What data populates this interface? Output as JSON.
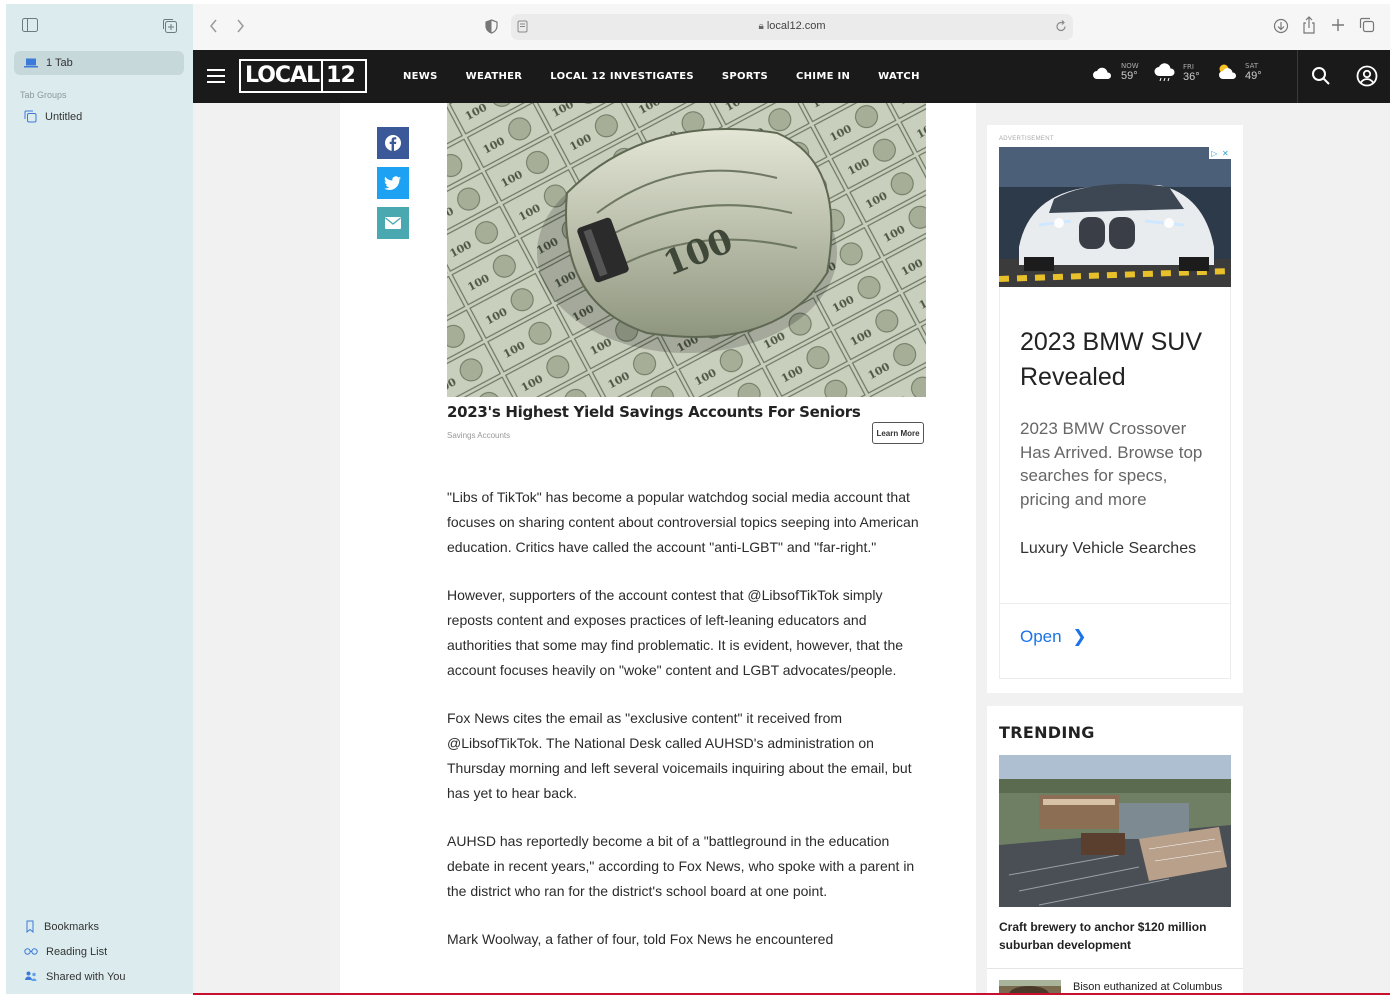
{
  "browser": {
    "sidebar": {
      "tab_count_label": "1 Tab",
      "tab_groups_title": "Tab Groups",
      "untitled_group": "Untitled",
      "bookmarks": "Bookmarks",
      "reading_list": "Reading List",
      "shared_with_you": "Shared with You"
    },
    "url": "local12.com"
  },
  "site": {
    "logo": "LOCAL",
    "logo_number": "12",
    "nav": [
      "NEWS",
      "WEATHER",
      "LOCAL 12 INVESTIGATES",
      "SPORTS",
      "CHIME IN",
      "WATCH"
    ],
    "weather": [
      {
        "label": "NOW",
        "temp": "59°",
        "icon": "partly-cloudy-night-icon"
      },
      {
        "label": "FRI",
        "temp": "36°",
        "icon": "cloudy-icon"
      },
      {
        "label": "SAT",
        "temp": "49°",
        "icon": "partly-sunny-icon"
      }
    ],
    "colors": {
      "nav_bg": "#1a1a1a",
      "facebook": "#3b5998",
      "twitter": "#1da1f2",
      "email": "#4aa8b0",
      "link_blue": "#1a73e8",
      "accent_red": "#c8102e"
    }
  },
  "sponsored": {
    "title": "2023's Highest Yield Savings Accounts For Seniors",
    "source": "Savings Accounts",
    "cta": "Learn More"
  },
  "article": {
    "paragraphs": [
      "\"Libs of TikTok\" has become a popular watchdog social media account that focuses on sharing content about controversial topics seeping into American education. Critics have called the account \"anti-LGBT\" and \"far-right.\"",
      "However, supporters of the account contest that @LibsofTikTok simply reposts content and exposes practices of left-leaning educators and authorities that some may find problematic. It is evident, however, that the account focuses heavily on \"woke\" content and LGBT advocates/people.",
      "Fox News cites the email as \"exclusive content\" it received from @LibsofTikTok. The National Desk called AUHSD's administration on Thursday morning and left several voicemails inquiring about the email, but has yet to hear back.",
      "AUHSD has reportedly become a bit of a \"battleground in the education debate in recent years,\" according to Fox News, who spoke with a parent in the district who ran for the district's school board at one point.",
      "Mark Woolway, a father of four, told Fox News he encountered"
    ]
  },
  "ad": {
    "label": "ADVERTISEMENT",
    "headline": "2023 BMW SUV Revealed",
    "description": "2023 BMW Crossover Has Arrived. Browse top searches for specs, pricing and more",
    "sponsor": "Luxury Vehicle Searches",
    "cta": "Open"
  },
  "trending": {
    "title": "TRENDING",
    "top_story": "Craft brewery to anchor $120 million suburban development",
    "second_story": "Bison euthanized at Columbus"
  }
}
